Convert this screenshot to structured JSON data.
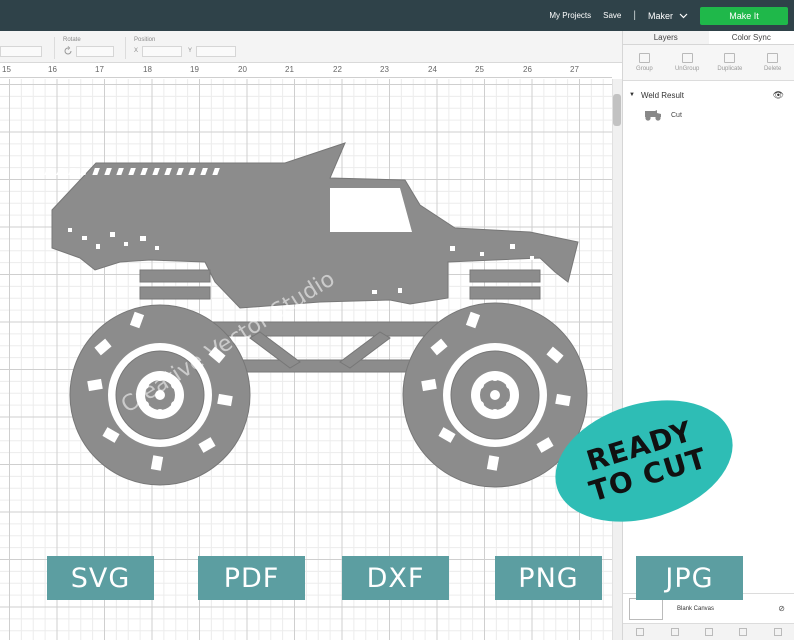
{
  "header": {
    "my_projects": "My Projects",
    "save": "Save",
    "separator": "|",
    "machine": "Maker",
    "make_it": "Make It"
  },
  "toolbar": {
    "rotate_label": "Rotate",
    "position_label": "Position",
    "x_label": "X",
    "y_label": "Y"
  },
  "ruler": {
    "numbers": [
      "15",
      "16",
      "17",
      "18",
      "19",
      "20",
      "21",
      "22",
      "23",
      "24",
      "25",
      "26",
      "27"
    ]
  },
  "panel": {
    "tabs": [
      "Layers",
      "Color Sync"
    ],
    "actions": [
      "Group",
      "UnGroup",
      "Duplicate",
      "Delete"
    ],
    "layer_group_name": "Weld Result",
    "layer_item_name": "Cut",
    "blank_canvas_label": "Blank Canvas"
  },
  "overlay": {
    "badge_line1": "READY",
    "badge_line2": "TO CUT",
    "formats": [
      "SVG",
      "PDF",
      "DXF",
      "PNG",
      "JPG"
    ],
    "watermark": "Creative Vector Studio"
  },
  "colors": {
    "topbar": "#2f4249",
    "make_it": "#1fb84a",
    "badge": "#2ebdb5",
    "format_button": "#5c9ea1",
    "design": "#8c8c8c"
  }
}
